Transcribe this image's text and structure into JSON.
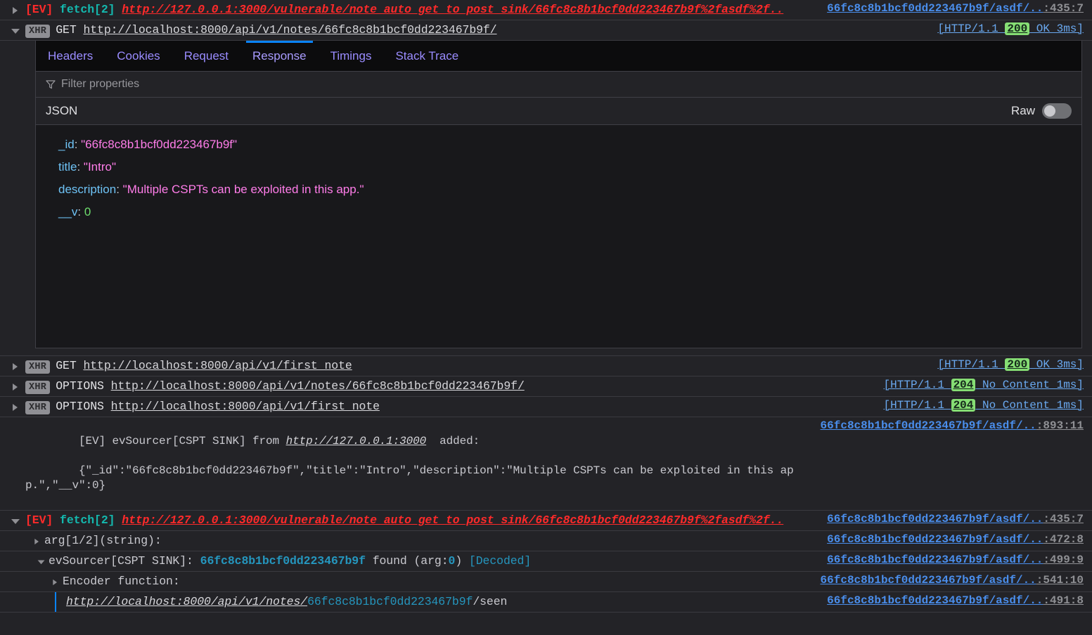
{
  "rows": {
    "ev_fetch_top": {
      "ev_tag": "[EV]",
      "fetch_tag": "fetch[2]",
      "url": "http://127.0.0.1:3000/vulnerable/note_auto_get_to_post_sink/66fc8c8b1bcf0dd223467b9f%2fasdf%2f..",
      "source_link": "66fc8c8b1bcf0dd223467b9f/asdf/..",
      "source_pos": ":435:7"
    },
    "xhr_get_note": {
      "badge": "XHR",
      "method": "GET",
      "url": "http://localhost:8000/api/v1/notes/66fc8c8b1bcf0dd223467b9f/",
      "status_prefix": "[HTTP/1.1 ",
      "status_code": "200",
      "status_suffix": " OK 3ms]"
    },
    "xhr_get_first_note": {
      "badge": "XHR",
      "method": "GET",
      "url": "http://localhost:8000/api/v1/first_note",
      "status_prefix": "[HTTP/1.1 ",
      "status_code": "200",
      "status_suffix": " OK 3ms]"
    },
    "xhr_options_note": {
      "badge": "XHR",
      "method": "OPTIONS",
      "url": "http://localhost:8000/api/v1/notes/66fc8c8b1bcf0dd223467b9f/",
      "status_prefix": "[HTTP/1.1 ",
      "status_code": "204",
      "status_suffix": " No Content 1ms]"
    },
    "xhr_options_first_note": {
      "badge": "XHR",
      "method": "OPTIONS",
      "url": "http://localhost:8000/api/v1/first_note",
      "status_prefix": "[HTTP/1.1 ",
      "status_code": "204",
      "status_suffix": " No Content 1ms]"
    },
    "ev_sourcer_added": {
      "prefix": "[EV] evSourcer[CSPT SINK] from ",
      "origin": "http://127.0.0.1:3000",
      "suffix": "  added:",
      "payload": "{\"_id\":\"66fc8c8b1bcf0dd223467b9f\",\"title\":\"Intro\",\"description\":\"Multiple CSPTs can be exploited in this app.\",\"__v\":0}",
      "source_link": "66fc8c8b1bcf0dd223467b9f/asdf/..",
      "source_pos": ":893:11"
    },
    "ev_fetch_bottom": {
      "ev_tag": "[EV]",
      "fetch_tag": "fetch[2]",
      "url": "http://127.0.0.1:3000/vulnerable/note_auto_get_to_post_sink/66fc8c8b1bcf0dd223467b9f%2fasdf%2f..",
      "source_link": "66fc8c8b1bcf0dd223467b9f/asdf/..",
      "source_pos": ":435:7"
    },
    "arg_string": {
      "label": "arg[1/2](string):",
      "source_link": "66fc8c8b1bcf0dd223467b9f/asdf/..",
      "source_pos": ":472:8"
    },
    "ev_sourcer_found": {
      "label": "evSourcer[CSPT SINK]: ",
      "id": "66fc8c8b1bcf0dd223467b9f",
      "found": " found (arg:",
      "arg_num": "0",
      "paren": ") ",
      "decoded": "[Decoded]",
      "source_link": "66fc8c8b1bcf0dd223467b9f/asdf/..",
      "source_pos": ":499:9"
    },
    "encoder_function": {
      "label": "Encoder function:",
      "source_link": "66fc8c8b1bcf0dd223467b9f/asdf/..",
      "source_pos": ":541:10"
    },
    "decoded_url": {
      "base": "http://localhost:8000/api/v1/notes/",
      "id": "66fc8c8b1bcf0dd223467b9f",
      "tail": "/seen",
      "source_link": "66fc8c8b1bcf0dd223467b9f/asdf/..",
      "source_pos": ":491:8"
    }
  },
  "detail_panel": {
    "tabs": [
      {
        "label": "Headers",
        "active": false
      },
      {
        "label": "Cookies",
        "active": false
      },
      {
        "label": "Request",
        "active": false
      },
      {
        "label": "Response",
        "active": true
      },
      {
        "label": "Timings",
        "active": false
      },
      {
        "label": "Stack Trace",
        "active": false
      }
    ],
    "filter_placeholder": "Filter properties",
    "json_label": "JSON",
    "raw_label": "Raw",
    "raw_enabled": false,
    "json_rows": [
      {
        "key": "_id",
        "value": "\"66fc8c8b1bcf0dd223467b9f\"",
        "type": "string"
      },
      {
        "key": "title",
        "value": "\"Intro\"",
        "type": "string"
      },
      {
        "key": "description",
        "value": "\"Multiple CSPTs can be exploited in this app.\"",
        "type": "string"
      },
      {
        "key": "__v",
        "value": "0",
        "type": "number"
      }
    ]
  },
  "colors": {
    "background": "#232327",
    "panel_background": "#18181b",
    "tabbar_background": "#0c0c0d",
    "accent_blue": "#0a84ff",
    "error_red": "#ff2a2a",
    "fetch_teal": "#14b8ae",
    "status_green": "#86de74",
    "link_blue": "#4a8eec",
    "json_key": "#6ec2f5",
    "json_string": "#ff7de9",
    "json_number": "#6ede6e"
  }
}
